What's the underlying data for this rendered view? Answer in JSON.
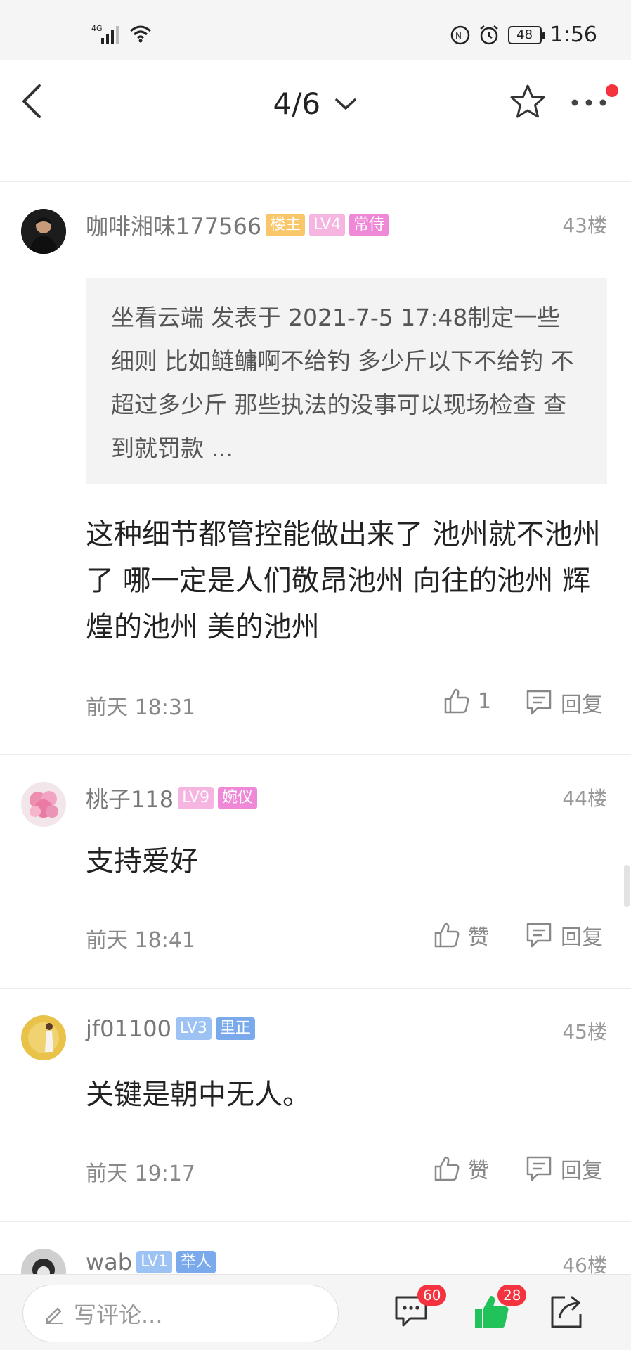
{
  "status_bar": {
    "network": "4G",
    "battery": "48",
    "time": "1:56"
  },
  "nav": {
    "page_indicator": "4/6"
  },
  "posts": [
    {
      "username": "咖啡湘味177566",
      "badges": [
        "楼主",
        "LV4",
        "常侍"
      ],
      "floor": "43楼",
      "quote": "坐看云端 发表于 2021-7-5 17:48制定一些细则 比如鲢鳙啊不给钓  多少斤以下不给钓  不超过多少斤  那些执法的没事可以现场检查 查到就罚款 ...",
      "content": "这种细节都管控能做出来了 池州就不池州了 哪一定是人们敬昂池州  向往的池州 辉煌的池州 美的池州",
      "time": "前天 18:31",
      "like_label": "1",
      "reply_label": "回复"
    },
    {
      "username": "桃子118",
      "badges": [
        "LV9",
        "婉仪"
      ],
      "floor": "44楼",
      "content": "支持爱好",
      "time": "前天 18:41",
      "like_label": "赞",
      "reply_label": "回复"
    },
    {
      "username": "jf01100",
      "badges": [
        "LV3",
        "里正"
      ],
      "floor": "45楼",
      "content": "关键是朝中无人。",
      "time": "前天 19:17",
      "like_label": "赞",
      "reply_label": "回复"
    },
    {
      "username": "wab",
      "badges": [
        "LV1",
        "举人"
      ],
      "floor": "46楼"
    }
  ],
  "bottom_bar": {
    "comment_placeholder": "写评论...",
    "comment_count": "60",
    "like_count": "28"
  },
  "colors": {
    "badge_orange": "#f9c66a",
    "badge_pink": "#f6b4e0",
    "badge_magenta": "#ee88d7",
    "badge_blue": "#9cc3f3",
    "like_green": "#21c25a",
    "notification_red": "#f5333f"
  }
}
